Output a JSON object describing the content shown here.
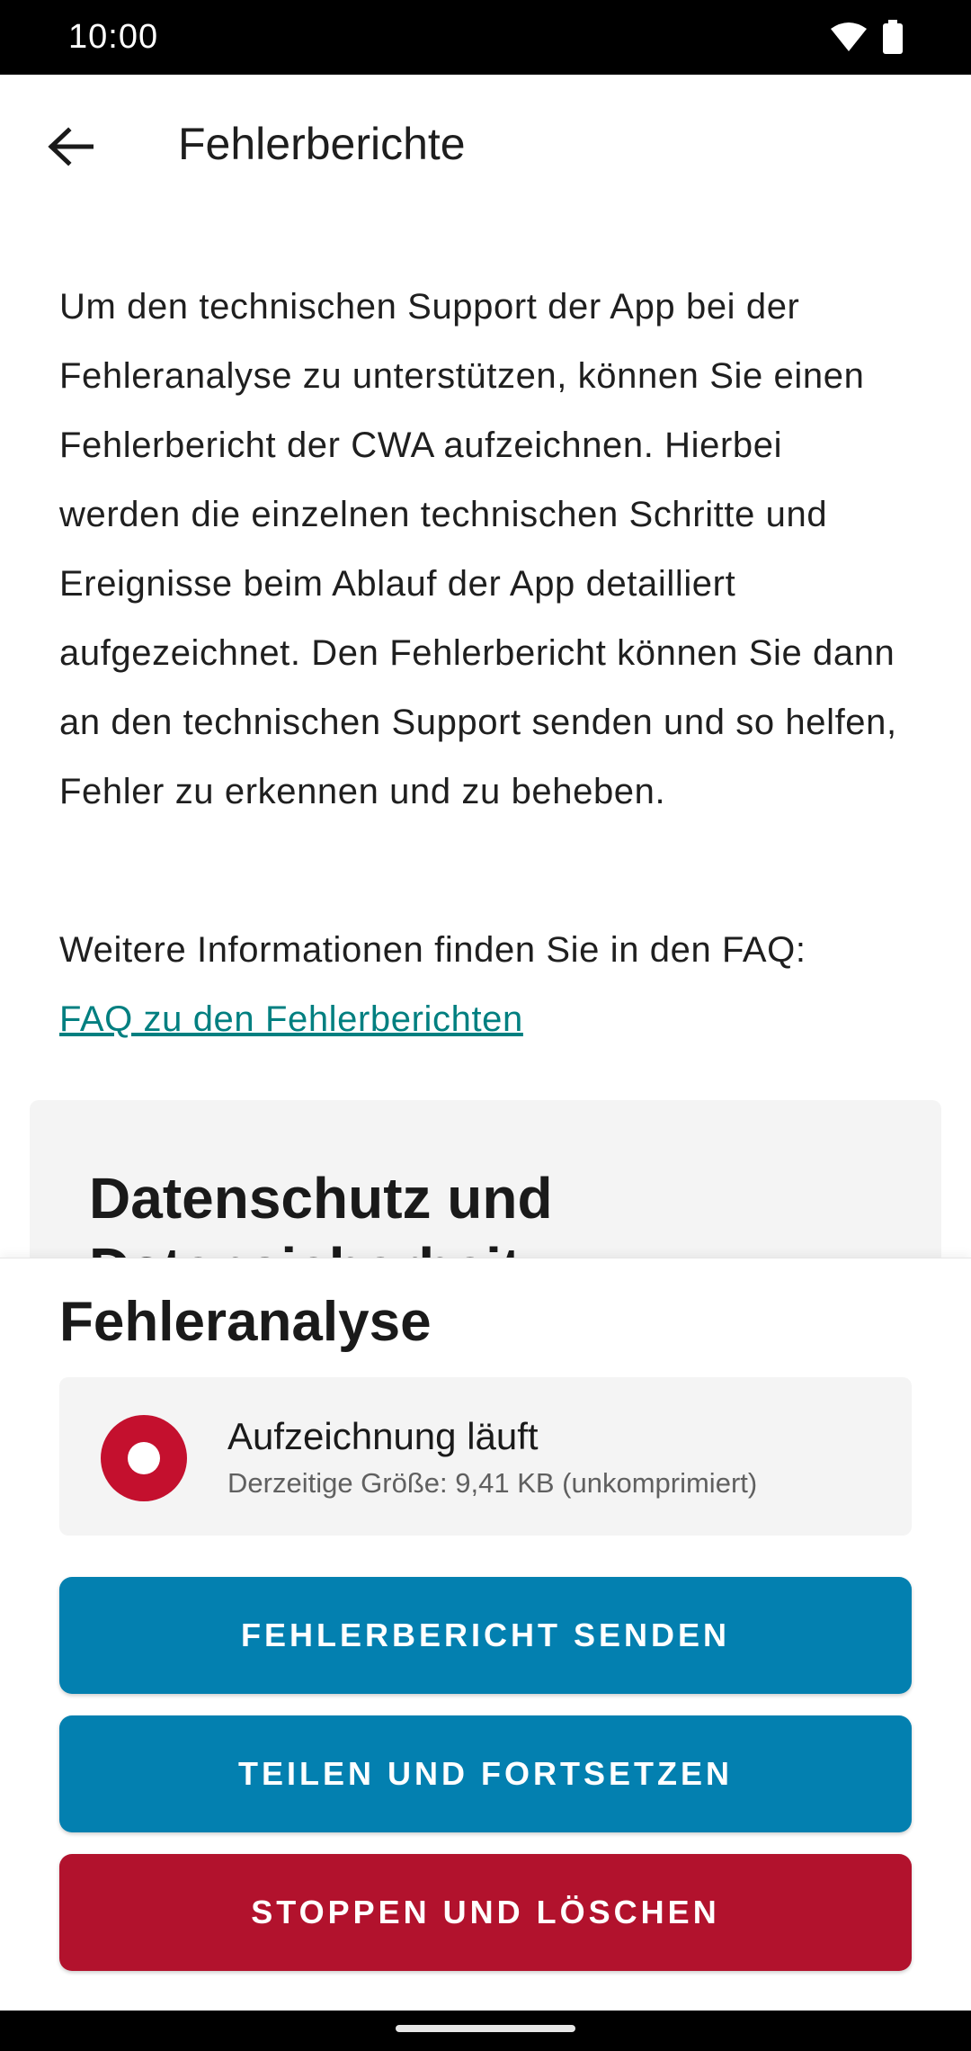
{
  "status_bar": {
    "time": "10:00",
    "icons": [
      "wifi-icon",
      "battery-icon"
    ]
  },
  "app_bar": {
    "back_icon": "arrow-back-icon",
    "title": "Fehlerberichte"
  },
  "intro": {
    "text": "Um den technischen Support der App bei der Fehleranalyse zu unterstützen, können Sie einen Fehlerbericht der CWA aufzeichnen. Hierbei werden die einzelnen technischen Schritte und Ereignisse beim Ablauf der App detailliert aufgezeichnet. Den Fehlerbericht können Sie dann an den technischen Support senden und so helfen, Fehler zu erkennen und zu beheben."
  },
  "more_info": {
    "text": "Weitere Informationen finden Sie in den FAQ:",
    "link": "FAQ zu den Fehlerberichten"
  },
  "privacy_card": {
    "title": "Datenschutz und Datensicherheit"
  },
  "bottom_sheet": {
    "title": "Fehleranalyse",
    "recording": {
      "status": "Aufzeichnung läuft",
      "size": "Derzeitige Größe: 9,41 KB (unkomprimiert)"
    },
    "buttons": {
      "send": "FEHLERBERICHT SENDEN",
      "share": "TEILEN UND FORTSETZEN",
      "stop": "STOPPEN UND LÖSCHEN"
    }
  },
  "colors": {
    "primary_button": "#0380b0",
    "danger_button": "#b2122d",
    "recording_red": "#c4102e",
    "link": "#007f80"
  }
}
